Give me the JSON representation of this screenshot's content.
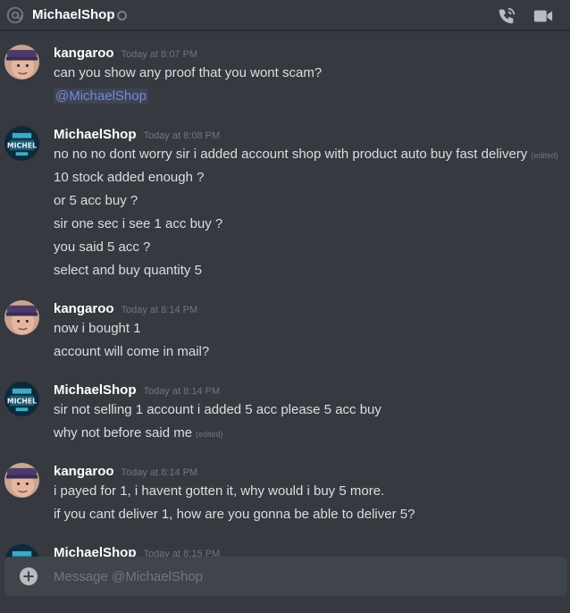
{
  "header": {
    "title": "MichaelShop",
    "icons": [
      "at-icon",
      "status-dot",
      "phone-call-icon",
      "video-call-icon"
    ]
  },
  "messages": [
    {
      "author": "kangaroo",
      "timestamp": "Today at 8:07 PM",
      "lines": [
        {
          "text": "can you show any proof that you wont scam?"
        },
        {
          "text": "@MichaelShop",
          "mention": true
        }
      ]
    },
    {
      "author": "MichaelShop",
      "timestamp": "Today at 8:08 PM",
      "lines": [
        {
          "text": "no no no dont worry sir i added account shop with product auto buy fast delivery",
          "edited": "(edited)"
        },
        {
          "text": "10 stock added enough ?"
        },
        {
          "text": "or 5 acc buy ?"
        },
        {
          "text": "sir one sec i see 1 acc buy ?"
        },
        {
          "text": "you said 5 acc ?"
        },
        {
          "text": "select and buy quantity 5"
        }
      ]
    },
    {
      "author": "kangaroo",
      "timestamp": "Today at 8:14 PM",
      "lines": [
        {
          "text": "now i bought 1"
        },
        {
          "text": "account will come in mail?"
        }
      ]
    },
    {
      "author": "MichaelShop",
      "timestamp": "Today at 8:14 PM",
      "lines": [
        {
          "text": "sir not selling 1 account i added 5 acc please 5 acc buy"
        },
        {
          "text": "why not before said me",
          "edited": "(edited)"
        }
      ]
    },
    {
      "author": "kangaroo",
      "timestamp": "Today at 8:14 PM",
      "lines": [
        {
          "text": "i payed for 1, i havent gotten it, why would i buy 5 more."
        },
        {
          "text": "if you cant deliver 1, how are you gonna be able to deliver 5?"
        }
      ]
    },
    {
      "author": "MichaelShop",
      "timestamp": "Today at 8:15 PM",
      "lines": []
    }
  ],
  "composer": {
    "placeholder": "Message @MichaelShop"
  },
  "colors": {
    "background": "#36393f",
    "composer": "#40444b",
    "mention": "#7289da",
    "timestamp": "#72767d"
  }
}
